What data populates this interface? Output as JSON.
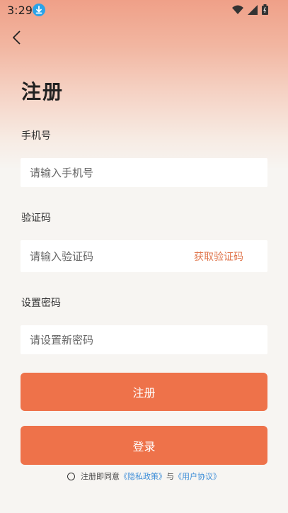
{
  "status": {
    "time": "3:29"
  },
  "page": {
    "title": "注册"
  },
  "phone": {
    "label": "手机号",
    "placeholder": "请输入手机号"
  },
  "code": {
    "label": "验证码",
    "placeholder": "请输入验证码",
    "get_code": "获取验证码"
  },
  "password": {
    "label": "设置密码",
    "placeholder": "请设置新密码"
  },
  "buttons": {
    "register": "注册",
    "login": "登录"
  },
  "agreement": {
    "prefix": "注册即同意",
    "privacy": "《隐私政策》",
    "and": "与",
    "user": "《用户协议》"
  },
  "colors": {
    "accent": "#EE724A",
    "link": "#3C8DD8",
    "get_code": "#E0764D"
  },
  "icons": [
    "download-badge-icon",
    "wifi-icon",
    "signal-icon",
    "battery-icon",
    "back-arrow-icon"
  ]
}
